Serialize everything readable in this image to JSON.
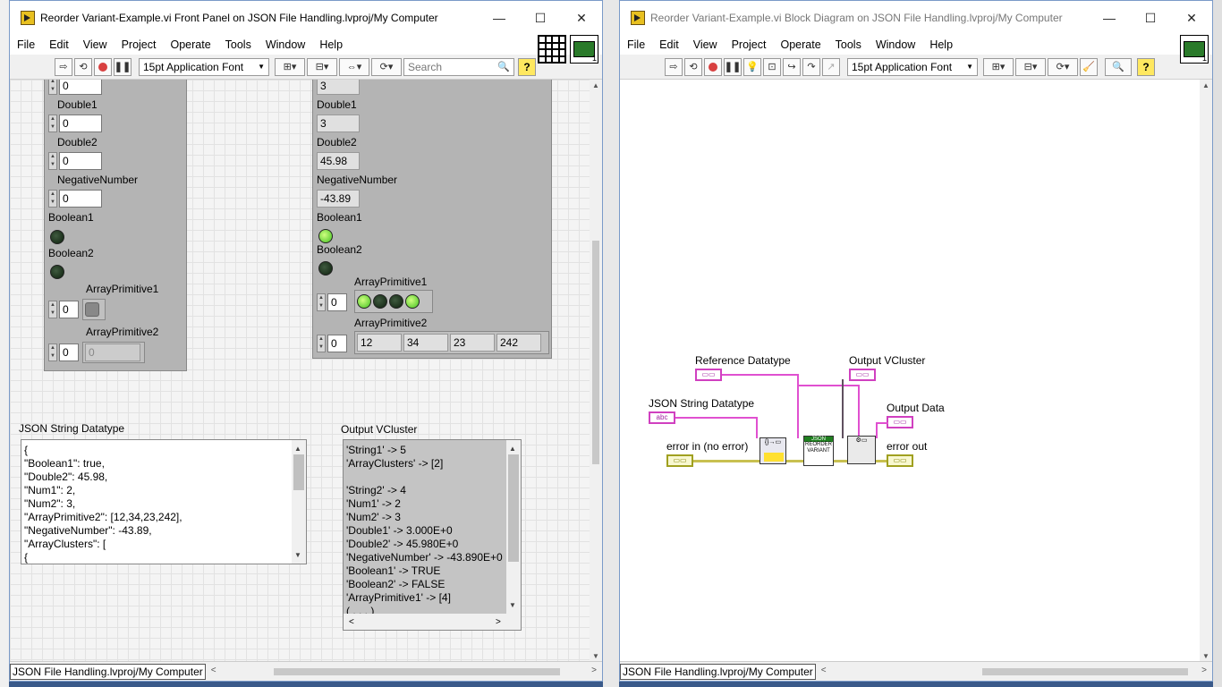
{
  "fp": {
    "title": "Reorder Variant-Example.vi Front Panel on JSON File Handling.lvproj/My Computer",
    "menu": [
      "File",
      "Edit",
      "View",
      "Project",
      "Operate",
      "Tools",
      "Window",
      "Help"
    ],
    "font": "15pt Application Font",
    "search_placeholder": "Search",
    "status_path": "JSON File Handling.lvproj/My Computer",
    "left_cluster": {
      "top_value": "0",
      "double1_label": "Double1",
      "double1": "0",
      "double2_label": "Double2",
      "double2": "0",
      "neg_label": "NegativeNumber",
      "neg": "0",
      "bool1_label": "Boolean1",
      "bool2_label": "Boolean2",
      "arrprim1_label": "ArrayPrimitive1",
      "arrprim1_index": "0",
      "arrprim2_label": "ArrayPrimitive2",
      "arrprim2_index": "0",
      "arrprim2_val": "0"
    },
    "right_cluster": {
      "top_value": "3",
      "double1_label": "Double1",
      "double1": "3",
      "double2_label": "Double2",
      "double2": "45.98",
      "neg_label": "NegativeNumber",
      "neg": "-43.89",
      "bool1_label": "Boolean1",
      "bool2_label": "Boolean2",
      "arrprim1_label": "ArrayPrimitive1",
      "arrprim1_index": "0",
      "arrprim2_label": "ArrayPrimitive2",
      "arrprim2_index": "0",
      "arrprim2_values": [
        "12",
        "34",
        "23",
        "242"
      ]
    },
    "json_string_label": "JSON String Datatype",
    "json_string_lines": [
      "{",
      "\"Boolean1\": true,",
      "\"Double2\": 45.98,",
      "\"Num1\": 2,",
      "\"Num2\": 3,",
      "\"ArrayPrimitive2\": [12,34,23,242],",
      "\"NegativeNumber\": -43.89,",
      "\"ArrayClusters\": [",
      "{"
    ],
    "output_vcluster_label": "Output VCluster",
    "output_lines": [
      "'String1' -> 5",
      "'ArrayClusters' -> [2]",
      "",
      "'String2' -> 4",
      "'Num1' -> 2",
      "'Num2' -> 3",
      "'Double1' -> 3.000E+0",
      "'Double2' -> 45.980E+0",
      "'NegativeNumber' -> -43.890E+0",
      "'Boolean1' -> TRUE",
      "'Boolean2' -> FALSE",
      "'ArrayPrimitive1' -> [4]",
      "( . . . )"
    ]
  },
  "bd": {
    "title": "Reorder Variant-Example.vi Block Diagram on JSON File Handling.lvproj/My Computer",
    "menu": [
      "File",
      "Edit",
      "View",
      "Project",
      "Operate",
      "Tools",
      "Window",
      "Help"
    ],
    "font": "15pt Application Font",
    "status_path": "JSON File Handling.lvproj/My Computer",
    "labels": {
      "ref": "Reference Datatype",
      "json": "JSON String Datatype",
      "errin": "error in (no error)",
      "outv": "Output VCluster",
      "outd": "Output Data",
      "errout": "error out"
    },
    "node_text": "REORDER VARIANT",
    "node_tag": "JSON"
  },
  "glyphs": {
    "minimize": "—",
    "maximize": "☐",
    "close": "✕",
    "dropdown": "▼",
    "search": "🔍",
    "help": "?",
    "spin_up": "▲",
    "spin_down": "▼",
    "scroll_up": "▲",
    "scroll_down": "▼",
    "scroll_left": "<",
    "scroll_right": ">"
  }
}
